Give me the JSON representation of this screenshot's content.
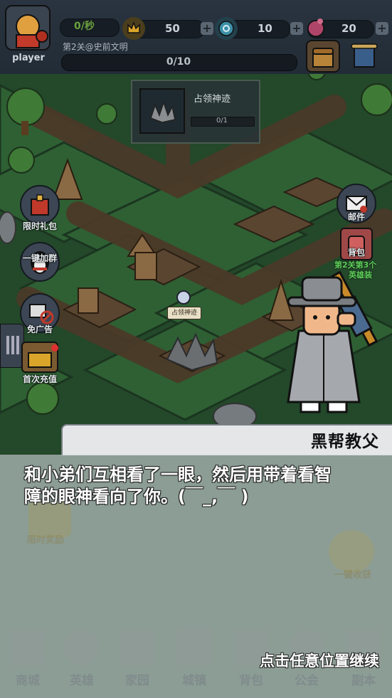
{
  "top_bar": {
    "player_name": "player",
    "production_rate": "0/秒",
    "stage_name": "第2关@史前文明",
    "progress_text": "0/10",
    "resources": [
      {
        "icon": "crown-icon",
        "value": "50"
      },
      {
        "icon": "gem-swirl-icon",
        "value": "10"
      },
      {
        "icon": "heart-gem-icon",
        "value": "20"
      }
    ],
    "plus_label": "+"
  },
  "popup": {
    "title": "占领神迹",
    "progress": "0/1"
  },
  "map_label": "占领神迹",
  "side_buttons_left": [
    {
      "icon": "gift-bag-icon",
      "label": "限时礼包"
    },
    {
      "icon": "penguin-icon",
      "label": "一键加群"
    },
    {
      "icon": "no-ads-icon",
      "label": "免广告"
    },
    {
      "icon": "treasure-chest-icon",
      "label": "首次充值"
    }
  ],
  "side_buttons_right": [
    {
      "icon": "mail-icon",
      "label": "邮件"
    },
    {
      "icon": "backpack-icon",
      "label": "背包"
    }
  ],
  "right_hint": "第2关第3个",
  "right_hint2": "英雄装",
  "dialog": {
    "speaker": "黑帮教父",
    "text_line1": "和小弟们互相看了一眼，然后用带着看智",
    "text_line2": "障的眼神看向了你。(￣_,￣ )",
    "continue_hint": "点击任意位置继续"
  },
  "faded_labels": {
    "left": "限时奖励",
    "right": "一键收获"
  },
  "bottom_nav": [
    {
      "icon": "shop-icon",
      "label": "商城"
    },
    {
      "icon": "hero-icon",
      "label": "英雄"
    },
    {
      "icon": "home-icon",
      "label": "家园"
    },
    {
      "icon": "town-icon",
      "label": "城镇"
    },
    {
      "icon": "bag-icon",
      "label": "背包"
    },
    {
      "icon": "guild-icon",
      "label": "公会"
    },
    {
      "icon": "dungeon-icon",
      "label": "副本"
    }
  ],
  "colors": {
    "grass": "#2b5a30",
    "path": "#4a3a28",
    "dialog_bg": "#cdd2d7",
    "speaker_tab": "#e4e6e8"
  }
}
